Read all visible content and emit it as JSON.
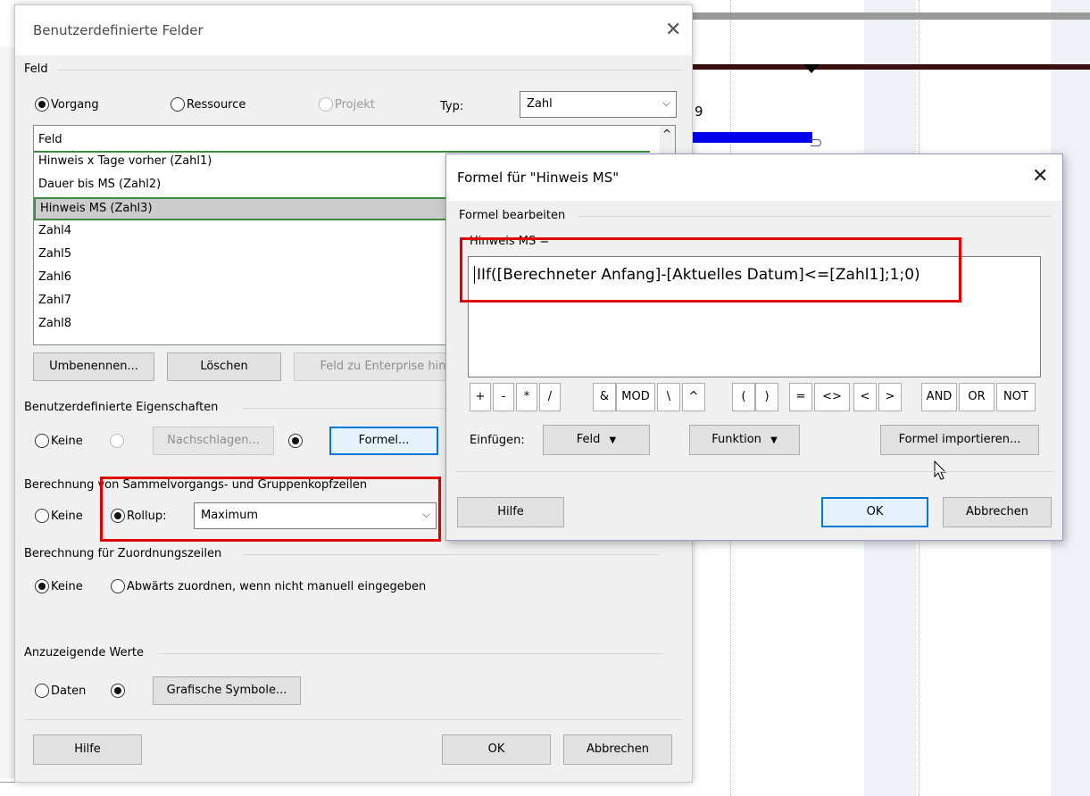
{
  "background": {
    "gantt_fragment": "9"
  },
  "custom_fields_dialog": {
    "title": "Benutzerdefinierte Felder",
    "field_group": "Feld",
    "radio_task": "Vorgang",
    "radio_resource": "Ressource",
    "radio_project": "Projekt",
    "type_label": "Typ:",
    "type_value": "Zahl",
    "list_header": "Feld",
    "fields": [
      "Hinweis x Tage vorher (Zahl1)",
      "Dauer bis MS (Zahl2)",
      "Hinweis MS (Zahl3)",
      "Zahl4",
      "Zahl5",
      "Zahl6",
      "Zahl7",
      "Zahl8"
    ],
    "rename_button": "Umbenennen...",
    "delete_button": "Löschen",
    "enterprise_button": "Feld zu Enterprise hin",
    "custom_props_group": "Benutzerdefinierte Eigenschaften",
    "radio_none": "Keine",
    "lookup_button": "Nachschlagen...",
    "formula_button": "Formel...",
    "summary_calc_group": "Berechnung von Sammelvorgangs- und Gruppenkopfzeilen",
    "radio_rollup": "Rollup:",
    "rollup_value": "Maximum",
    "assignment_calc_group": "Berechnung für Zuordnungszeilen",
    "radio_rolldown": "Abwärts zuordnen, wenn nicht manuell eingegeben",
    "display_group": "Anzuzeigende Werte",
    "radio_data": "Daten",
    "graphical_button": "Grafische Symbole...",
    "help_button": "Hilfe",
    "ok_button": "OK",
    "cancel_button": "Abbrechen"
  },
  "formula_dialog": {
    "title": "Formel für \"Hinweis MS\"",
    "edit_group": "Formel bearbeiten",
    "field_label": "Hinweis MS =",
    "formula": "IIf([Berechneter Anfang]-[Aktuelles Datum]<=[Zahl1];1;0)",
    "operators": [
      "+",
      "-",
      "*",
      "/",
      "&",
      "MOD",
      "\\",
      "^",
      "(",
      ")",
      "=",
      "<>",
      "<",
      ">",
      "AND",
      "OR",
      "NOT"
    ],
    "insert_label": "Einfügen:",
    "field_button": "Feld",
    "function_button": "Funktion",
    "import_button": "Formel importieren...",
    "help_button": "Hilfe",
    "ok_button": "OK",
    "cancel_button": "Abbrechen"
  },
  "colors": {
    "highlight": "#e00000",
    "gantt_bar": "#0000ee",
    "summary_bar": "#3a0f0f",
    "focus": "#0078d7"
  }
}
